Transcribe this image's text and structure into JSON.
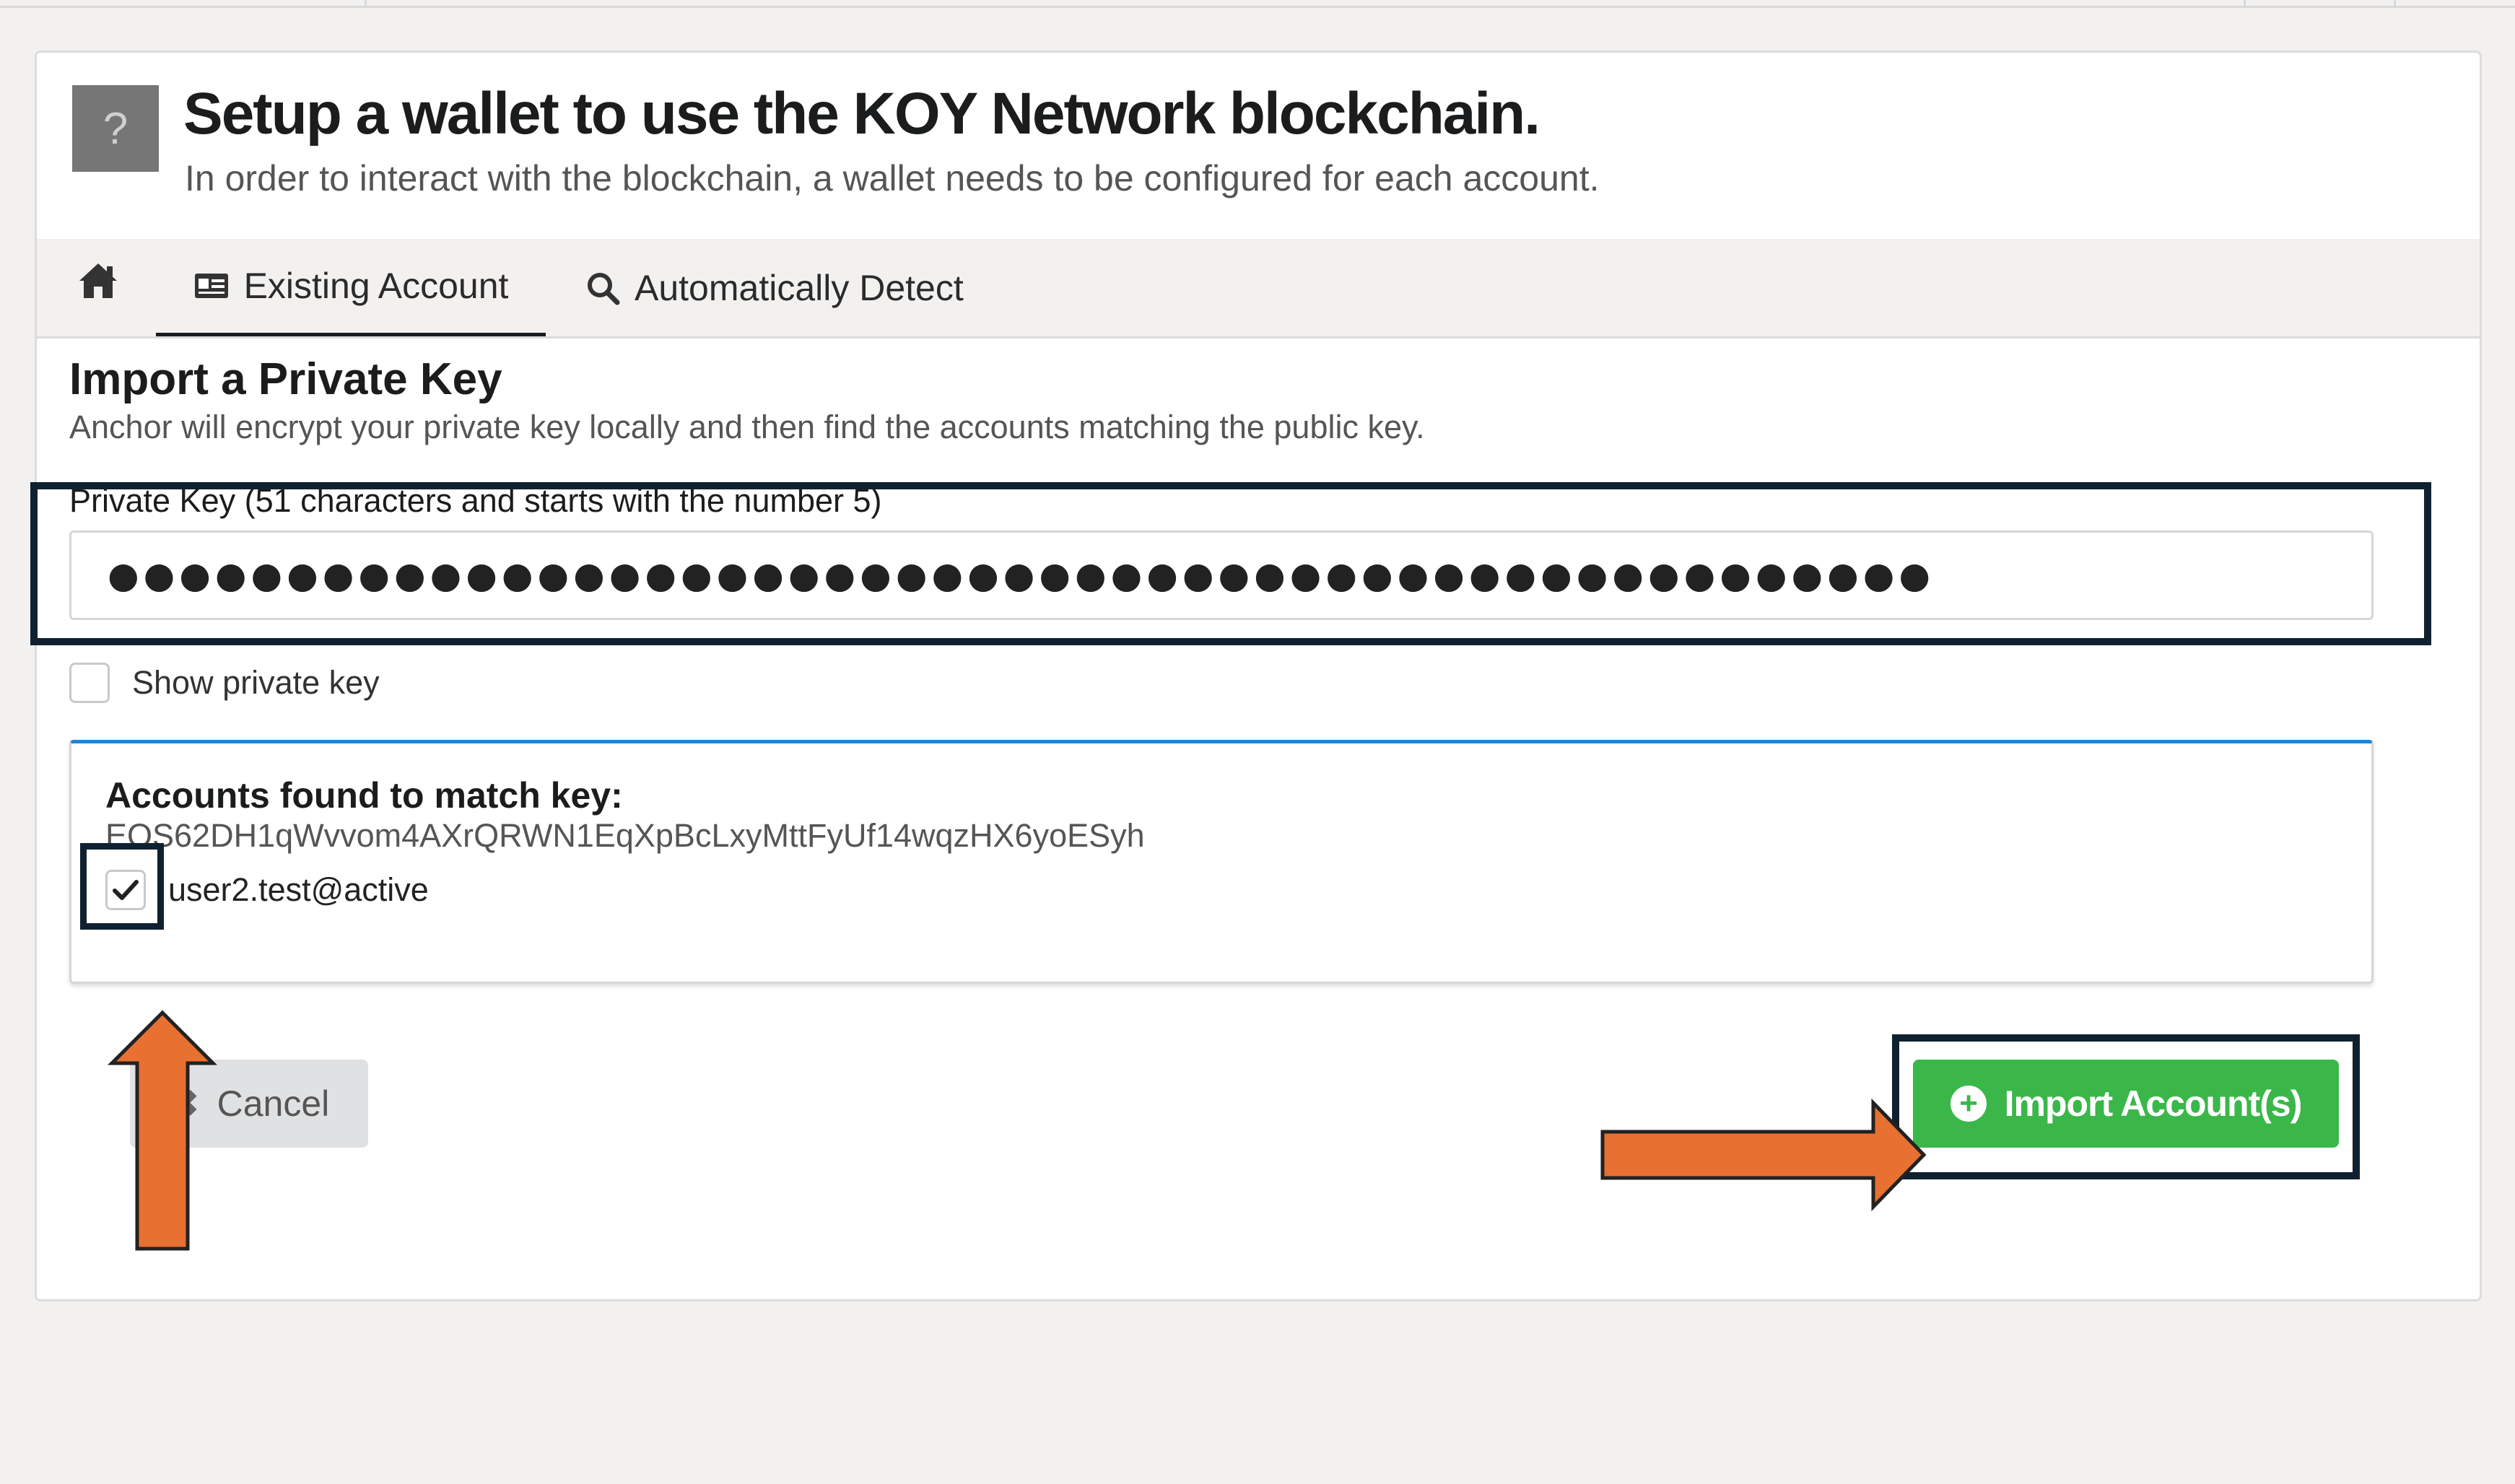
{
  "header": {
    "help_icon": "question-mark-icon",
    "help_glyph": "?",
    "title": "Setup a wallet to use the KOY Network blockchain.",
    "subtitle": "In order to interact with the blockchain, a wallet needs to be configured for each account."
  },
  "tabs": [
    {
      "label": "",
      "icon": "home-icon"
    },
    {
      "label": "Existing Account",
      "icon": "id-card-icon",
      "active": true
    },
    {
      "label": "Automatically Detect",
      "icon": "search-icon"
    }
  ],
  "import": {
    "title": "Import a Private Key",
    "description": "Anchor will encrypt your private key locally and then find the accounts matching the public key.",
    "key_label": "Private Key (51 characters and starts with the number 5)",
    "key_value": "●●●●●●●●●●●●●●●●●●●●●●●●●●●●●●●●●●●●●●●●●●●●●●●●●●●",
    "show_key_label": "Show private key",
    "show_key_checked": false
  },
  "accounts": {
    "title": "Accounts found to match key:",
    "public_key": "EOS62DH1qWvvom4AXrQRWN1EqXpBcLxyMttFyUf14wqzHX6yoESyh",
    "items": [
      {
        "label": "user2.test@active",
        "checked": true
      }
    ]
  },
  "actions": {
    "cancel_label": "Cancel",
    "import_label": "Import Account(s)"
  },
  "colors": {
    "import_button": "#3bb74a",
    "highlight_border": "#0f2130",
    "annotation_arrow": "#e87030",
    "accounts_box_accent": "#2185d0"
  }
}
